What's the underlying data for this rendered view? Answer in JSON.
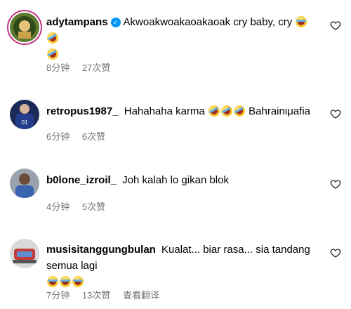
{
  "comments": [
    {
      "username": "adytampans",
      "verified": true,
      "text": "Akwoakwoakaoakaoak cry baby, cry",
      "emojis_after": [
        "joy",
        "rofl",
        "rofl"
      ],
      "time": "8分钟",
      "likes": "27次赞",
      "translate": ""
    },
    {
      "username": "retropus1987_",
      "verified": false,
      "text": "Hahahaha karma",
      "emojis_after": [
        "rofl",
        "rofl",
        "rofl"
      ],
      "text_after_emojis": "Bahrainιμafia",
      "time": "6分钟",
      "likes": "6次赞",
      "translate": ""
    },
    {
      "username": "b0lone_izroil_",
      "verified": false,
      "text": "Joh kalah lo gikan blok",
      "time": "4分钟",
      "likes": "5次赞",
      "translate": ""
    },
    {
      "username": "musisitanggungbulan",
      "verified": false,
      "text": "Kualat... biar rasa... sia tandang semua lagi",
      "emojis_after": [
        "joy",
        "joy",
        "joy"
      ],
      "time": "7分钟",
      "likes": "13次赞",
      "translate": "查看翻译"
    }
  ],
  "icons": {
    "like": "heart-outline-icon",
    "verified": "verified-badge-icon",
    "emoji_joy": "face-with-tears-of-joy",
    "emoji_rofl": "rolling-on-floor-laughing"
  },
  "colors": {
    "meta_text": "#737373",
    "verified_blue": "#0095f6"
  }
}
